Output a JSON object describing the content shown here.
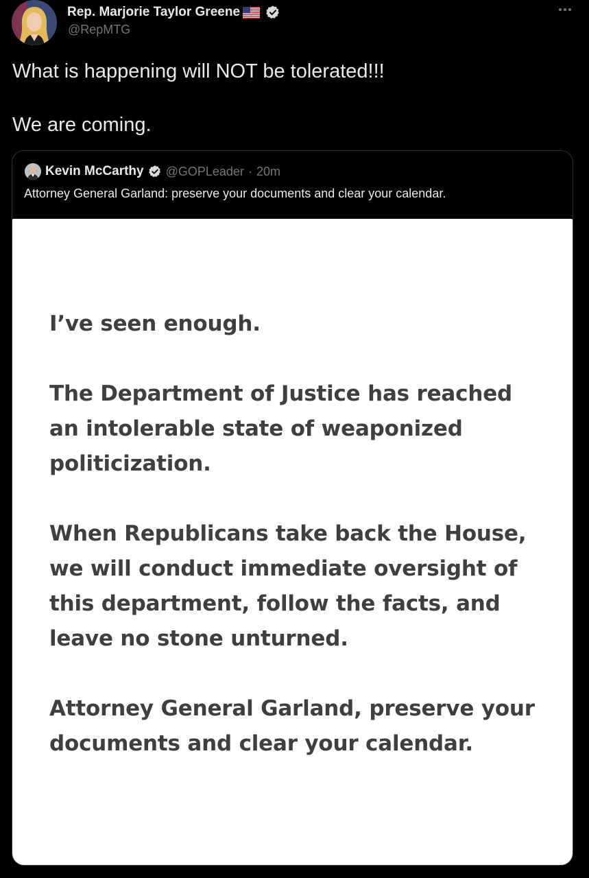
{
  "author": {
    "name": "Rep. Marjorie Taylor Greene",
    "handle": "@RepMTG",
    "verified": true,
    "flag": "us-flag-icon"
  },
  "tweet": {
    "lines": [
      "What is happening will NOT be tolerated!!!",
      "We are coming."
    ]
  },
  "quote_tweet": {
    "name": "Kevin McCarthy",
    "handle": "@GOPLeader",
    "separator": "·",
    "time": "20m",
    "verified": true,
    "text": "Attorney General Garland: preserve your documents and clear your calendar.",
    "statement_paragraphs": [
      "I’ve seen enough.",
      "The Department of Justice has reached an intolerable state of weaponized politicization.",
      "When Republicans take back the House, we will conduct immediate oversight of this department, follow the facts, and leave no stone unturned.",
      "Attorney General Garland, preserve your documents and clear your calendar."
    ]
  },
  "colors": {
    "background": "#000000",
    "primary_text": "#e7e9ea",
    "secondary_text": "#71767b",
    "statement_text": "#3f3f3f",
    "statement_bg": "#ffffff",
    "border": "#2f3336"
  },
  "icons": [
    "avatar",
    "us-flag-icon",
    "verified-icon",
    "more-icon"
  ]
}
